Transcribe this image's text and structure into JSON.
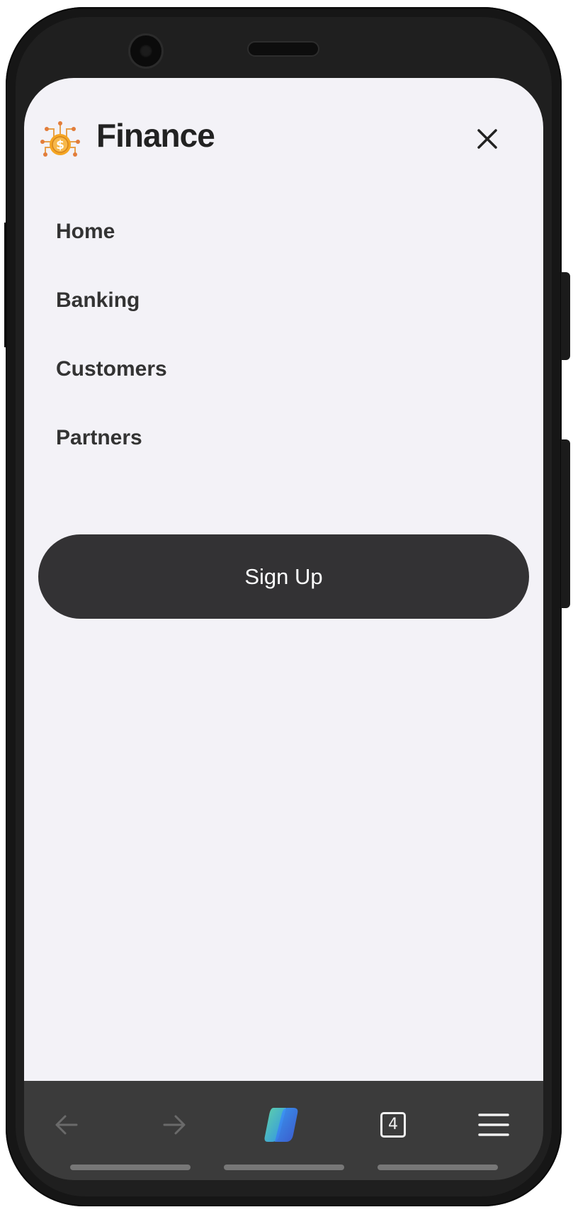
{
  "brand": {
    "name": "Finance",
    "icon": "money-network-icon",
    "icon_color": "#f2a43a"
  },
  "header": {
    "close_icon": "close-icon"
  },
  "menu": {
    "items": [
      {
        "label": "Home"
      },
      {
        "label": "Banking"
      },
      {
        "label": "Customers"
      },
      {
        "label": "Partners"
      }
    ]
  },
  "cta": {
    "label": "Sign Up",
    "background": "#333234"
  },
  "browser_toolbar": {
    "back_icon": "arrow-left-icon",
    "forward_icon": "arrow-right-icon",
    "copilot_icon": "copilot-icon",
    "tab_count": "4",
    "menu_icon": "hamburger-menu-icon"
  },
  "colors": {
    "screen_background": "#f3f2f7",
    "text": "#333333",
    "toolbar_background": "#3b3b3b"
  }
}
